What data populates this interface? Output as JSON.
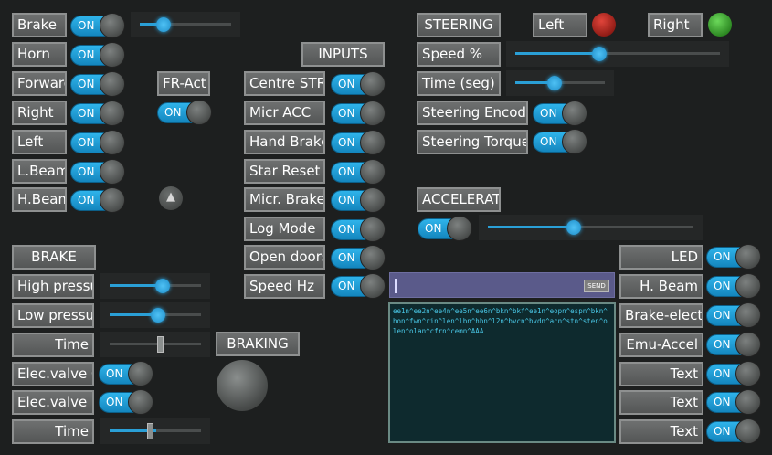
{
  "left_controls": [
    {
      "label": "Brake",
      "toggle": "ON"
    },
    {
      "label": "Horn",
      "toggle": "ON"
    },
    {
      "label": "Forward",
      "toggle": "ON"
    },
    {
      "label": "Right",
      "toggle": "ON"
    },
    {
      "label": "Left",
      "toggle": "ON"
    },
    {
      "label": "L.Beam",
      "toggle": "ON"
    },
    {
      "label": "H.Beam",
      "toggle": "ON"
    }
  ],
  "brake_slider": {
    "value": 0.3
  },
  "fr_act": {
    "label": "FR-Act",
    "toggle": "ON"
  },
  "inputs": {
    "header": "INPUTS",
    "items": [
      {
        "label": "Centre STR",
        "toggle": "ON"
      },
      {
        "label": "Micr ACC",
        "toggle": "ON"
      },
      {
        "label": "Hand Brake",
        "toggle": "ON"
      },
      {
        "label": "Star Reset",
        "toggle": "ON"
      },
      {
        "label": "Micr. Brake",
        "toggle": "ON"
      },
      {
        "label": "Log Mode",
        "toggle": "ON"
      },
      {
        "label": "Open doors",
        "toggle": "ON"
      },
      {
        "label": "Speed Hz",
        "toggle": "ON"
      }
    ]
  },
  "brake_section": {
    "header": "BRAKE",
    "rows": [
      {
        "label": "High pressure",
        "slider": 0.6
      },
      {
        "label": "Low pressure",
        "slider": 0.55
      },
      {
        "label": "Time",
        "slider": 0.55
      },
      {
        "label": "Elec.valve C",
        "toggle": "ON"
      },
      {
        "label": "Elec.valve D",
        "toggle": "ON"
      },
      {
        "label": "Time",
        "slider": 0.45
      }
    ],
    "braking_label": "BRAKING"
  },
  "steering": {
    "header": "STEERING",
    "left_label": "Left",
    "right_label": "Right",
    "speed_label": "Speed %",
    "speed_value": 0.45,
    "time_label": "Time (seg)",
    "time_value": 0.45,
    "encoder_label": "Steering Encoder",
    "encoder_toggle": "ON",
    "torque_label": "Steering Torque",
    "torque_toggle": "ON"
  },
  "accel": {
    "label": "ACCELERATION",
    "toggle": "ON",
    "slider": 0.45
  },
  "send": {
    "button": "SEND"
  },
  "console_text": "ee1n^ee2n^ee4n^ee5n^ee6n^bkn^bkf^ee1n^eopn^espn^bkn^hon^fwn^rin^len^lbn^hbn^l2n^bvcn^bvdn^acn^stn^sten^olen^olan^cfrn^cemn^AAA",
  "right_outputs": [
    {
      "label": "LED",
      "toggle": "ON"
    },
    {
      "label": "H. Beam",
      "toggle": "ON"
    },
    {
      "label": "Brake-electric",
      "toggle": "ON"
    },
    {
      "label": "Emu-Accel",
      "toggle": "ON"
    },
    {
      "label": "Text",
      "toggle": "ON"
    },
    {
      "label": "Text",
      "toggle": "ON"
    },
    {
      "label": "Text",
      "toggle": "ON"
    }
  ]
}
